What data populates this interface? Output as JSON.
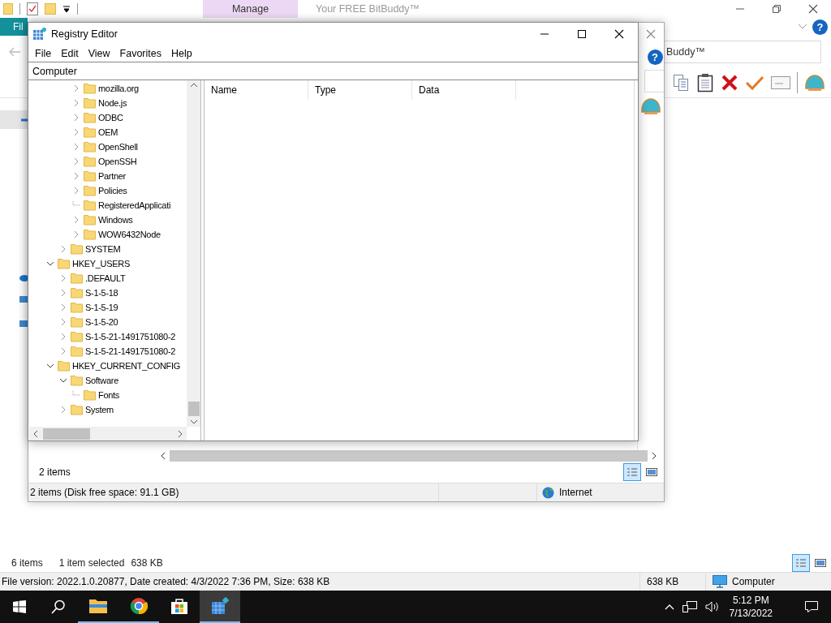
{
  "explorer": {
    "title": "Your FREE BitBuddy™",
    "context_tab": "Manage",
    "ribbon_tab": "Fil",
    "help_icon": "?",
    "search_text": "Buddy™",
    "status_count": "6 items",
    "status_selected": "1 item selected",
    "status_size": "638 KB",
    "views": [
      {
        "selected": true
      },
      {
        "selected": false
      }
    ],
    "details": "File version: 2022.1.0.20877, Date created: 4/3/2022 7:36 PM, Size: 638 KB",
    "details_size": "638 KB",
    "details_location": "Computer"
  },
  "browser_window": {
    "help_icon": "?",
    "status_count": "2 items",
    "views": [
      {
        "selected": true
      },
      {
        "selected": false
      }
    ],
    "status_text": "2 items (Disk free space: 91.1 GB)",
    "zone": "Internet"
  },
  "registry": {
    "title": "Registry Editor",
    "menu": [
      "File",
      "Edit",
      "View",
      "Favorites",
      "Help"
    ],
    "address": "Computer",
    "tree": [
      {
        "children": [
          {
            "children": [
              {
                "label": "mozilla.org",
                "kind": "branch",
                "expanded": false
              },
              {
                "label": "Node.js",
                "kind": "branch",
                "expanded": false
              },
              {
                "label": "ODBC",
                "kind": "branch",
                "expanded": false
              },
              {
                "label": "OEM",
                "kind": "branch",
                "expanded": false
              },
              {
                "label": "OpenShell",
                "kind": "branch",
                "expanded": false
              },
              {
                "label": "OpenSSH",
                "kind": "branch",
                "expanded": false
              },
              {
                "label": "Partner",
                "kind": "branch",
                "expanded": false
              },
              {
                "label": "Policies",
                "kind": "branch",
                "expanded": false
              },
              {
                "label": "RegisteredApplicati",
                "kind": "leaf"
              },
              {
                "label": "Windows",
                "kind": "branch",
                "expanded": false
              },
              {
                "label": "WOW6432Node",
                "kind": "branch",
                "expanded": false
              }
            ]
          },
          {
            "label": "SYSTEM",
            "kind": "branch",
            "expanded": false
          }
        ]
      },
      {
        "label": "HKEY_USERS",
        "kind": "branch",
        "expanded": true,
        "children": [
          {
            "label": ".DEFAULT",
            "kind": "branch",
            "expanded": false
          },
          {
            "label": "S-1-5-18",
            "kind": "branch",
            "expanded": false
          },
          {
            "label": "S-1-5-19",
            "kind": "branch",
            "expanded": false
          },
          {
            "label": "S-1-5-20",
            "kind": "branch",
            "expanded": false
          },
          {
            "label": "S-1-5-21-1491751080-2",
            "kind": "branch",
            "expanded": false
          },
          {
            "label": "S-1-5-21-1491751080-2",
            "kind": "branch",
            "expanded": false
          }
        ]
      },
      {
        "label": "HKEY_CURRENT_CONFIG",
        "kind": "branch",
        "expanded": true,
        "children": [
          {
            "label": "Software",
            "kind": "branch",
            "expanded": true,
            "children": [
              {
                "label": "Fonts",
                "kind": "leaf"
              }
            ]
          },
          {
            "label": "System",
            "kind": "branch",
            "expanded": false
          }
        ]
      }
    ],
    "columns": [
      "Name",
      "Type",
      "Data"
    ]
  },
  "taskbar": {
    "apps": [
      {
        "kind": "explorer",
        "running": true,
        "selected": false
      },
      {
        "kind": "chrome",
        "running": true,
        "selected": false
      },
      {
        "kind": "store",
        "running": false,
        "selected": false
      },
      {
        "kind": "regedit",
        "running": true,
        "selected": true
      }
    ],
    "time": "5:12 PM",
    "date": "7/13/2022"
  }
}
